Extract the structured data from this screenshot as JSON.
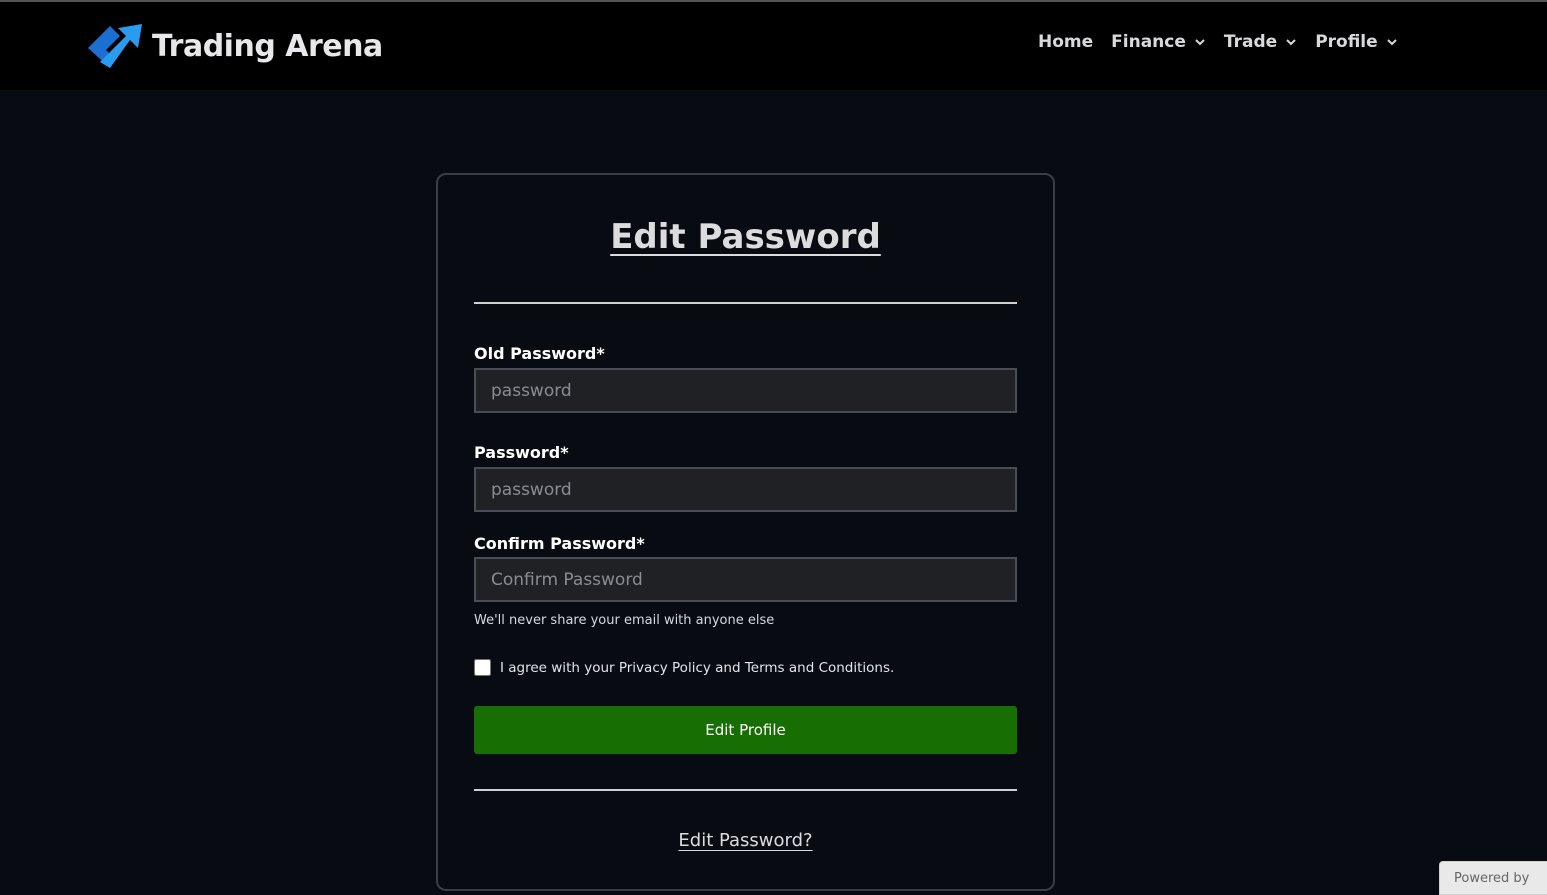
{
  "header": {
    "brand_name": "Trading Arena",
    "nav": [
      {
        "label": "Home",
        "has_dropdown": false
      },
      {
        "label": "Finance",
        "has_dropdown": true
      },
      {
        "label": "Trade",
        "has_dropdown": true
      },
      {
        "label": "Profile",
        "has_dropdown": true
      }
    ]
  },
  "form": {
    "title": "Edit Password",
    "old_password": {
      "label": "Old Password*",
      "placeholder": "password",
      "value": ""
    },
    "password": {
      "label": "Password*",
      "placeholder": "password",
      "value": ""
    },
    "confirm_password": {
      "label": "Confirm Password*",
      "placeholder": "Confirm Password",
      "value": ""
    },
    "help_text": "We'll never share your email with anyone else",
    "agree_label": "I agree with your Privacy Policy and Terms and Conditions.",
    "agree_checked": false,
    "submit_label": "Edit Profile",
    "bottom_link": "Edit Password?"
  },
  "footer_badge": "Powered by",
  "colors": {
    "background": "#080c12",
    "header": "#000000",
    "submit": "#176e02",
    "logo_blue": "#1e88e5"
  }
}
